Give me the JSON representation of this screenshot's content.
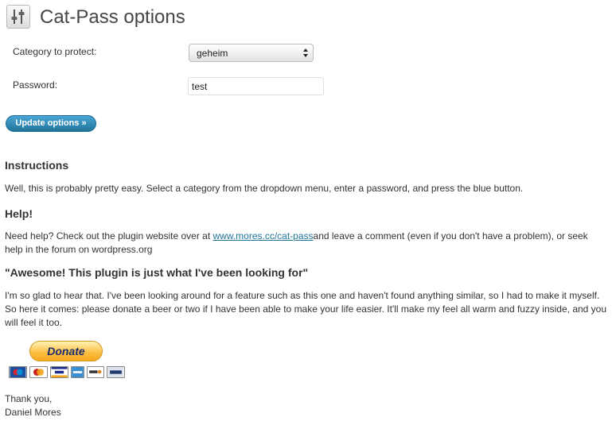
{
  "page": {
    "title": "Cat-Pass options",
    "icon": "settings-sliders-icon"
  },
  "form": {
    "category_label": "Category to protect:",
    "category_value": "geheim",
    "password_label": "Password:",
    "password_value": "test",
    "update_button": "Update options »"
  },
  "instructions": {
    "heading": "Instructions",
    "text": "Well, this is probably pretty easy. Select a category from the dropdown menu, enter a password, and press the blue button."
  },
  "help": {
    "heading": "Help!",
    "text_before": "Need help? Check out the plugin website over at ",
    "link": "www.mores.cc/cat-pass",
    "text_after": "and leave a comment (even if you don't have a problem), or seek help in the forum on wordpress.org"
  },
  "quote": {
    "heading": "\"Awesome! This plugin is just what I've been looking for\"",
    "text": "I'm so glad to hear that. I've been looking around for a feature such as this one and haven't found anything similar, so I had to make it myself. So here it comes: please donate a beer or two if I have been able to make your life easier. It'll make my feel all warm and fuzzy inside, and you will feel it too."
  },
  "donate": {
    "button": "Donate",
    "cards": [
      {
        "name": "Maestro",
        "color": "#1a4fa0"
      },
      {
        "name": "MasterCard",
        "color": "#cc2222"
      },
      {
        "name": "VISA",
        "color": "#1a2b8c"
      },
      {
        "name": "AMEX",
        "color": "#3b8fd0"
      },
      {
        "name": "DISCOVER",
        "color": "#e07b16"
      },
      {
        "name": "BANK",
        "color": "#1d3b6e"
      }
    ]
  },
  "closing": {
    "line1": "Thank you,",
    "line2": "Daniel Mores"
  },
  "colors": {
    "accent": "#21759b",
    "donate": "#fbbd3f"
  }
}
